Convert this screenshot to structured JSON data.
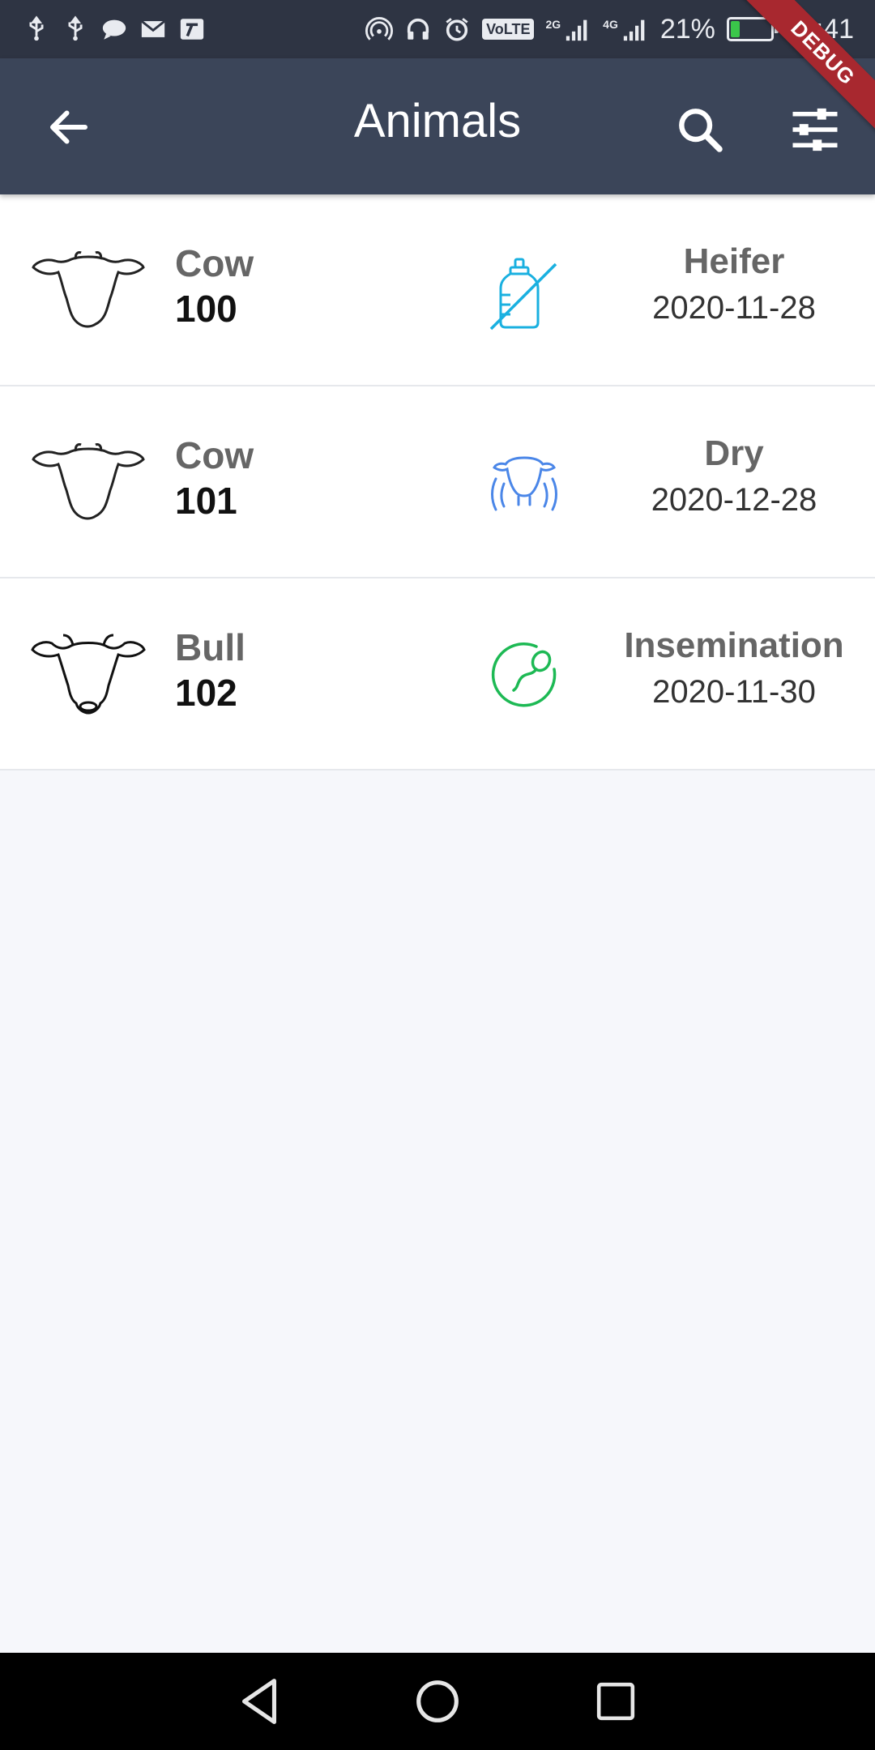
{
  "status_bar": {
    "signal_2g_label": "2G",
    "signal_4g_label": "4G",
    "volte_label": "VoLTE",
    "battery_percent": "21%",
    "battery_level": 0.21,
    "time": "16:41",
    "icons": [
      "usb-icon",
      "usb-icon",
      "chat-bubble-icon",
      "mail-icon",
      "app-icon",
      "hotspot-icon",
      "headset-icon",
      "alarm-icon"
    ]
  },
  "debug_banner": "DEBUG",
  "app_bar": {
    "title": "Animals",
    "icons": [
      "back-arrow-icon",
      "search-icon",
      "filter-sliders-icon"
    ]
  },
  "animals": [
    {
      "type": "Cow",
      "number": "100",
      "status": "Heifer",
      "date": "2020-11-28",
      "status_icon": "no-bottle-icon",
      "status_color": "#1ab0e0"
    },
    {
      "type": "Cow",
      "number": "101",
      "status": "Dry",
      "date": "2020-12-28",
      "status_icon": "cow-udder-icon",
      "status_color": "#4a86e8"
    },
    {
      "type": "Bull",
      "number": "102",
      "status": "Insemination",
      "date": "2020-11-30",
      "status_icon": "sperm-icon",
      "status_color": "#1db954"
    }
  ],
  "colors": {
    "status_bar": "#2e3443",
    "app_bar": "#3b4559",
    "background": "#f6f7fb",
    "debug_ribbon": "#a8282f"
  },
  "nav_bar": {
    "icons": [
      "back-triangle-icon",
      "home-circle-icon",
      "recents-square-icon"
    ]
  }
}
